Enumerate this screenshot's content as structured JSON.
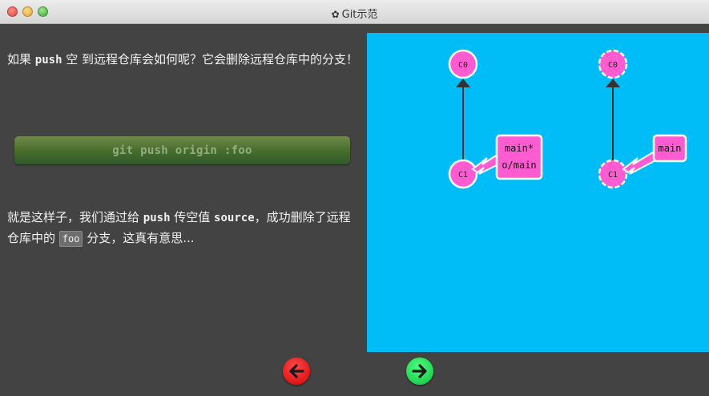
{
  "window": {
    "title": "Git示范"
  },
  "paragraph1": {
    "before": "如果 ",
    "keyword": "push",
    "after": " 空 到远程仓库会如何呢？它会删除远程仓库中的分支！"
  },
  "command": {
    "text": "git push origin :foo"
  },
  "paragraph2": {
    "before": "就是这样子，我们通过给 ",
    "keyword1": "push",
    "middle": " 传空值 ",
    "keyword2": "source",
    "after": "，成功删除了远程仓库中的 ",
    "code": "foo",
    "end": " 分支，这真有意思..."
  },
  "graph": {
    "local": {
      "commits": [
        "C0",
        "C1"
      ],
      "branch_labels": [
        "main*",
        "o/main"
      ]
    },
    "remote": {
      "commits": [
        "C0",
        "C1"
      ],
      "branch_labels": [
        "main"
      ]
    }
  },
  "nav": {
    "back_icon": "arrow-left-icon",
    "forward_icon": "arrow-right-icon"
  },
  "colors": {
    "viz_background": "#00bdf8",
    "commit_fill": "#ff5cd1",
    "back_button": "#e00000",
    "forward_button": "#16d048",
    "command_bar": "#476b2a"
  }
}
